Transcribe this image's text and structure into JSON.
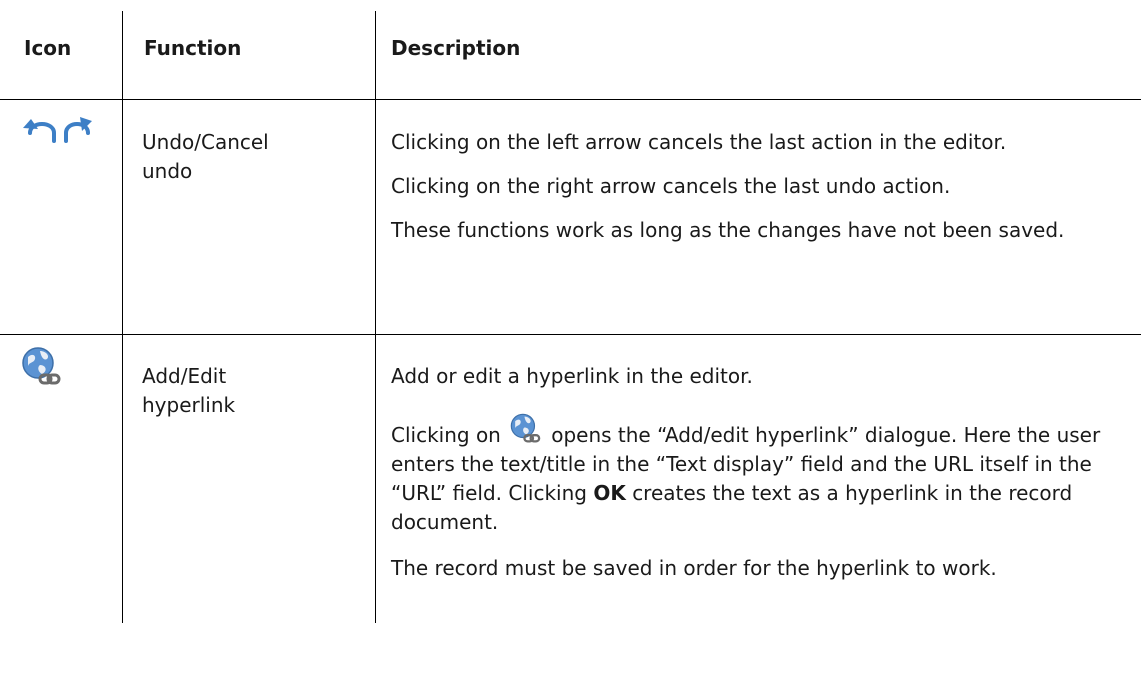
{
  "table": {
    "headers": {
      "icon": "Icon",
      "function": "Function",
      "description": "Description"
    },
    "rows": [
      {
        "icons": [
          "undo-arrow-icon",
          "redo-arrow-icon"
        ],
        "function_line1": "Undo/Cancel",
        "function_line2": "undo",
        "description": [
          "Clicking on the left arrow cancels the last action in the editor.",
          "Clicking on the right arrow cancels the last undo action.",
          "These functions work as long as the changes have not been saved."
        ]
      },
      {
        "icons": [
          "globe-link-icon"
        ],
        "function_line1": "Add/Edit",
        "function_line2": "hyperlink",
        "description_p1": "Add or edit a hyperlink in the editor.",
        "description_p2_a": "Clicking on",
        "description_p2_b": "opens the “Add/edit hyperlink” dialogue. Here the user enters the text/title in the “Text display” field and the URL itself in the “URL” field. Clicking",
        "description_p2_ok": "OK",
        "description_p2_c": "creates the text as a hyperlink in the record document.",
        "description_p3": "The record must be saved in order for the hyperlink to work."
      }
    ]
  },
  "colors": {
    "icon_blue": "#3d7fc6",
    "rule": "#000000",
    "text": "#1a1a1a"
  }
}
